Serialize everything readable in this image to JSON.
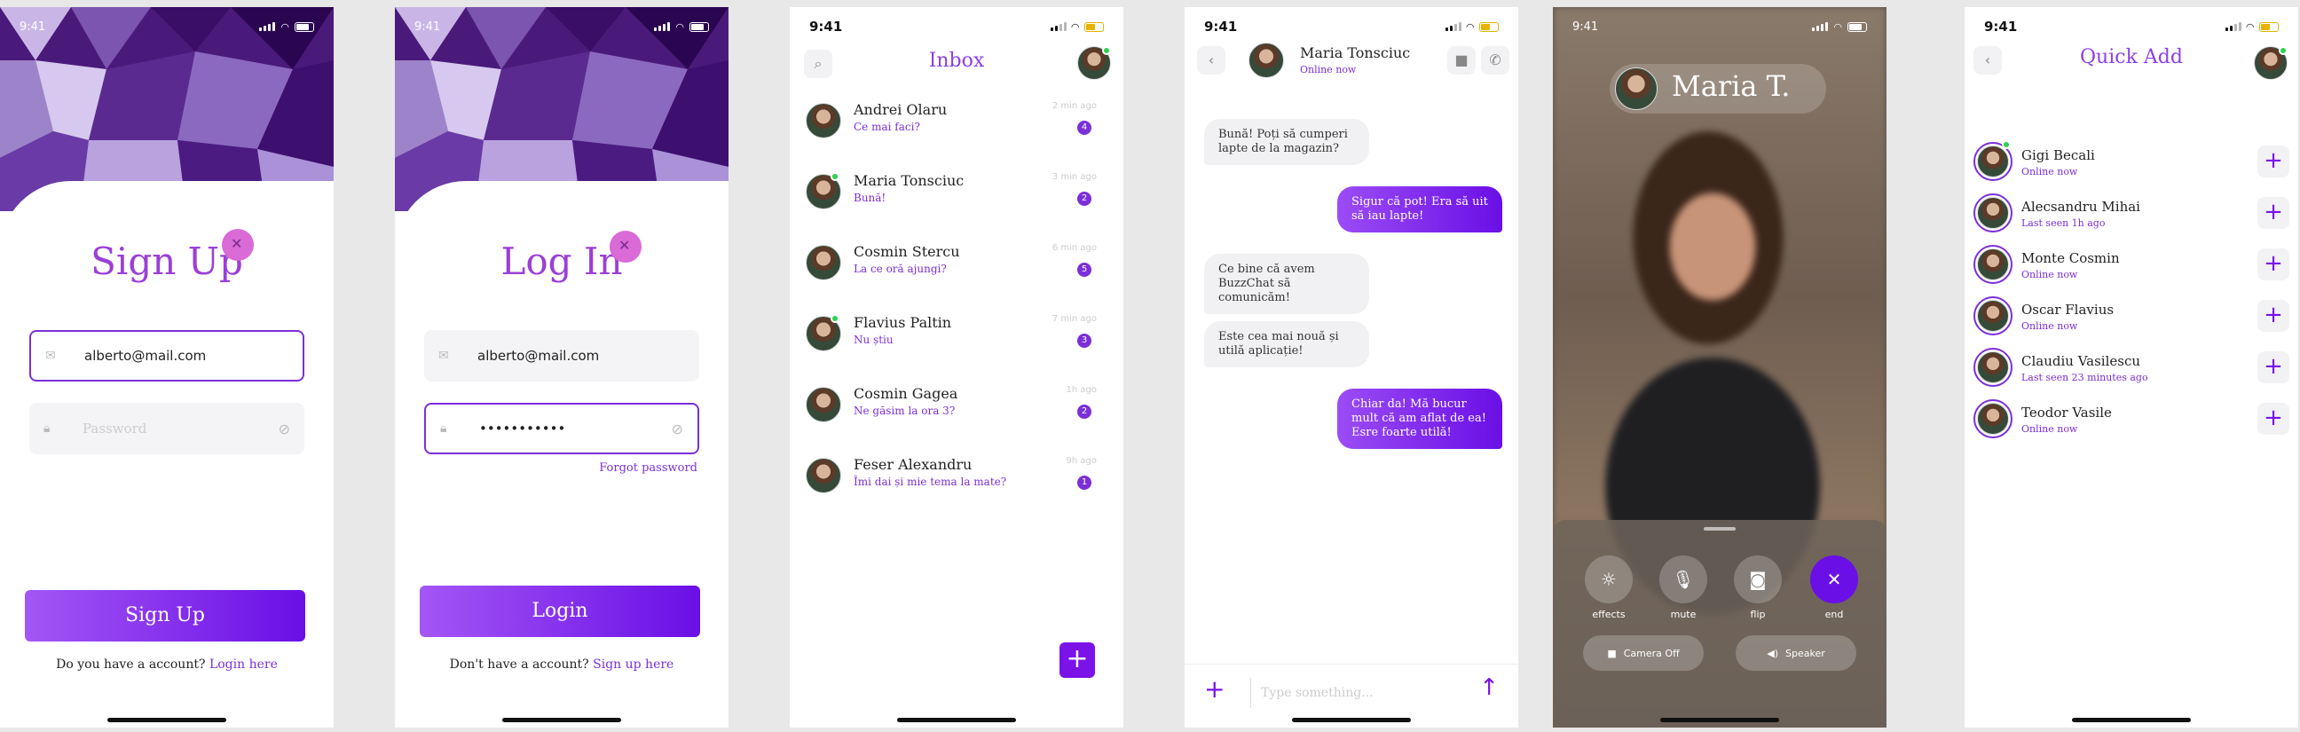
{
  "status_time": "9:41",
  "signup": {
    "title": "Sign Up",
    "email_value": "alberto@mail.com",
    "password_placeholder": "Password",
    "button": "Sign Up",
    "footer_text": "Do you have a account?",
    "footer_link": "Login here"
  },
  "login": {
    "title": "Log In",
    "email_value": "alberto@mail.com",
    "password_value": "•••••••••••",
    "forgot": "Forgot password",
    "button": "Login",
    "footer_text": "Don't have a account?",
    "footer_link": "Sign up here"
  },
  "inbox": {
    "title": "Inbox",
    "chats": [
      {
        "name": "Andrei Olaru",
        "message": "Ce mai faci?",
        "time": "2 min ago",
        "unread": "4"
      },
      {
        "name": "Maria Tonsciuc",
        "message": "Bună!",
        "time": "3 min ago",
        "unread": "2"
      },
      {
        "name": "Cosmin Stercu",
        "message": "La ce oră ajungi?",
        "time": "6 min ago",
        "unread": "5"
      },
      {
        "name": "Flavius Paltin",
        "message": "Nu știu",
        "time": "7 min ago",
        "unread": "3"
      },
      {
        "name": "Cosmin Gagea",
        "message": "Ne găsim la ora 3?",
        "time": "1h ago",
        "unread": "2"
      },
      {
        "name": "Feser Alexandru",
        "message": "Îmi dai și mie tema la mate?",
        "time": "9h ago",
        "unread": "1"
      }
    ],
    "fab": "+"
  },
  "conversation": {
    "contact_name": "Maria Tonsciuc",
    "contact_status": "Online now",
    "messages": [
      {
        "dir": "in",
        "text": "Bună! Poți să cumperi lapte de la magazin?"
      },
      {
        "dir": "out",
        "text": "Sigur că pot! Era să uit să iau lapte!"
      },
      {
        "dir": "in",
        "text": "Ce bine că avem BuzzChat să comunicăm!"
      },
      {
        "dir": "in",
        "text": "Este cea mai nouă și utilă aplicație!"
      },
      {
        "dir": "out",
        "text": "Chiar da! Mă bucur mult că am aflat de ea! Esre foarte utilă!"
      }
    ],
    "input_placeholder": "Type something..."
  },
  "call": {
    "caller": "Maria T.",
    "controls": [
      "effects",
      "mute",
      "flip",
      "end"
    ],
    "camera_off": "Camera Off",
    "speaker": "Speaker"
  },
  "quick_add": {
    "title": "Quick Add",
    "people": [
      {
        "name": "Gigi Becali",
        "status": "Online now"
      },
      {
        "name": "Alecsandru Mihai",
        "status": "Last seen 1h ago"
      },
      {
        "name": "Monte Cosmin",
        "status": "Online now"
      },
      {
        "name": "Oscar Flavius",
        "status": "Online now"
      },
      {
        "name": "Claudiu Vasilescu",
        "status": "Last seen 23 minutes ago"
      },
      {
        "name": "Teodor Vasile",
        "status": "Online now"
      }
    ]
  },
  "colors": {
    "accent": "#7b2fd8",
    "accent_dark": "#6a0fe6",
    "online": "#2cd24e"
  }
}
